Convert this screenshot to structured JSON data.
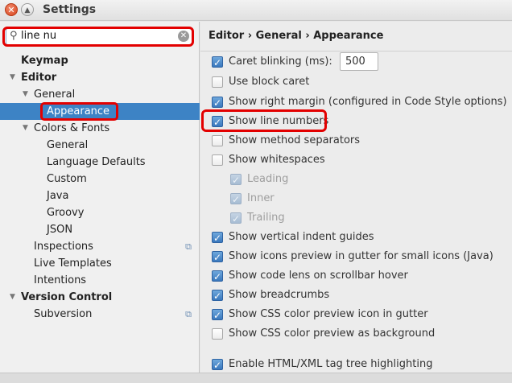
{
  "window": {
    "title": "Settings"
  },
  "search": {
    "value": "line nu"
  },
  "breadcrumb": "Editor › General › Appearance",
  "tree": [
    {
      "label": "Keymap",
      "bold": true,
      "arrow": ""
    },
    {
      "label": "Editor",
      "bold": true,
      "arrow": "▼"
    },
    {
      "label": "General",
      "arrow": "▼"
    },
    {
      "label": "Appearance",
      "selected": true,
      "arrow": ""
    },
    {
      "label": "Colors & Fonts",
      "arrow": "▼"
    },
    {
      "label": "General",
      "arrow": ""
    },
    {
      "label": "Language Defaults",
      "arrow": ""
    },
    {
      "label": "Custom",
      "arrow": ""
    },
    {
      "label": "Java",
      "arrow": ""
    },
    {
      "label": "Groovy",
      "arrow": ""
    },
    {
      "label": "JSON",
      "arrow": ""
    },
    {
      "label": "Inspections",
      "arrow": "",
      "badge": "copy-icon"
    },
    {
      "label": "Live Templates",
      "arrow": ""
    },
    {
      "label": "Intentions",
      "arrow": ""
    },
    {
      "label": "Version Control",
      "bold": true,
      "arrow": "▼"
    },
    {
      "label": "Subversion",
      "arrow": "",
      "badge": "copy-icon"
    }
  ],
  "options": [
    {
      "label": "Caret blinking (ms):",
      "checked": true,
      "value": "500"
    },
    {
      "label": "Use block caret",
      "checked": false
    },
    {
      "label": "Show right margin (configured in Code Style options)",
      "checked": true
    },
    {
      "label": "Show line numbers",
      "checked": true
    },
    {
      "label": "Show method separators",
      "checked": false
    },
    {
      "label": "Show whitespaces",
      "checked": false
    },
    {
      "label": "Leading",
      "checked": true,
      "disabled": true
    },
    {
      "label": "Inner",
      "checked": true,
      "disabled": true
    },
    {
      "label": "Trailing",
      "checked": true,
      "disabled": true
    },
    {
      "label": "Show vertical indent guides",
      "checked": true
    },
    {
      "label": "Show icons preview in gutter for small icons (Java)",
      "checked": true
    },
    {
      "label": "Show code lens on scrollbar hover",
      "checked": true
    },
    {
      "label": "Show breadcrumbs",
      "checked": true
    },
    {
      "label": "Show CSS color preview icon in gutter",
      "checked": true
    },
    {
      "label": "Show CSS color preview as background",
      "checked": false
    },
    {
      "label": "Enable HTML/XML tag tree highlighting",
      "checked": true
    }
  ],
  "colors": {
    "selection": "#3d83c5",
    "highlight": "#e30000",
    "checkbox": "#3a78bd"
  }
}
